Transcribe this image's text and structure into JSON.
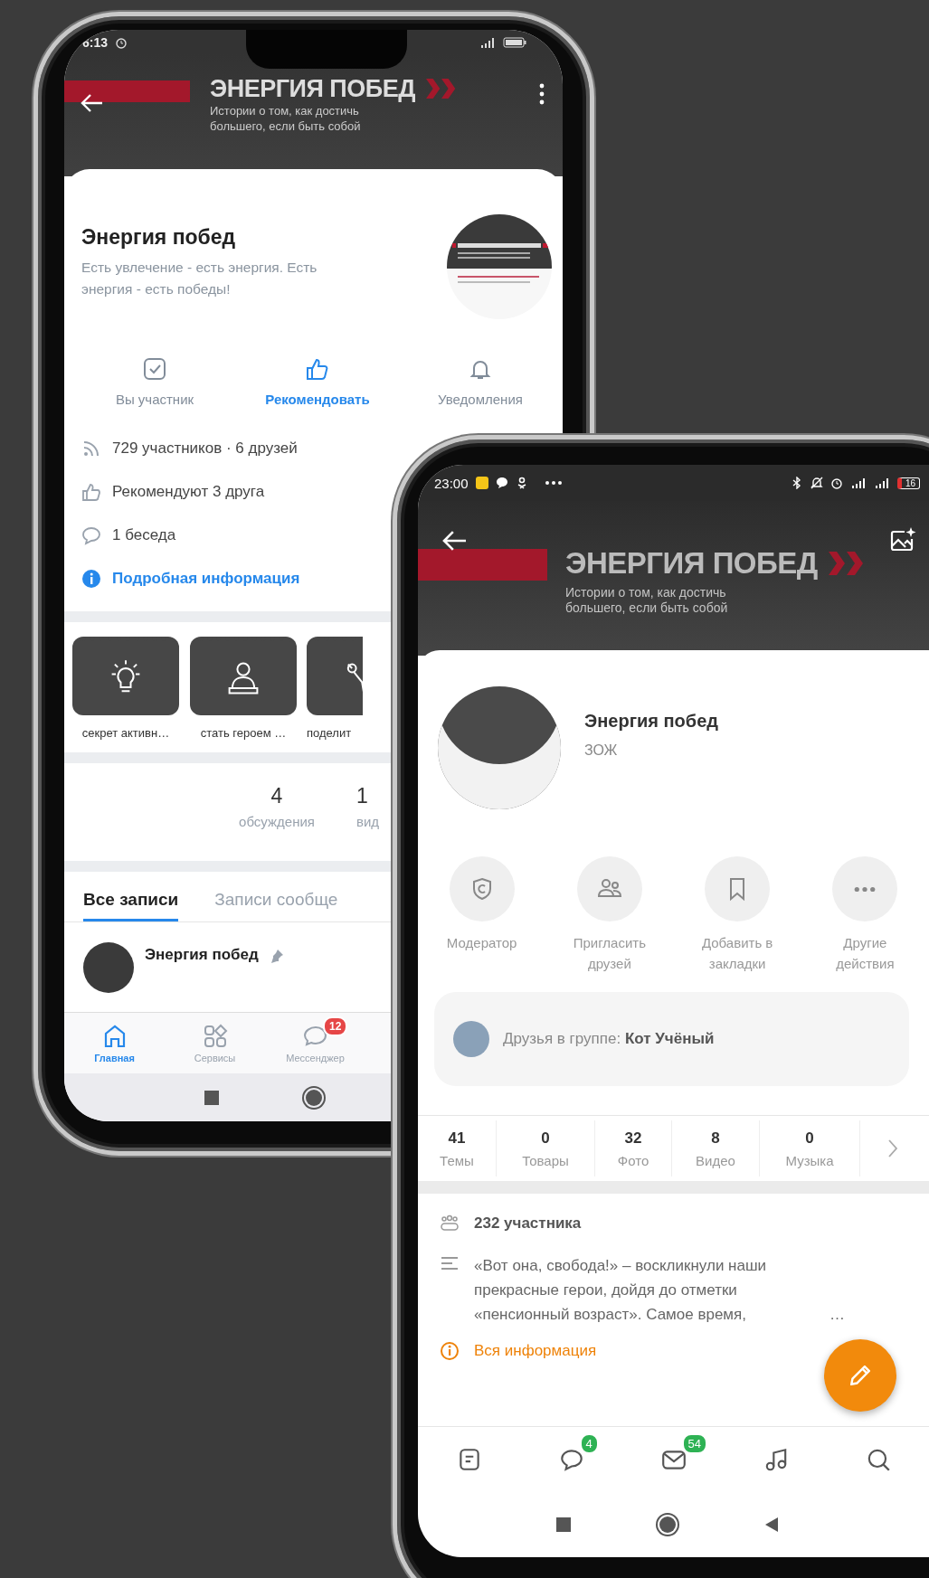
{
  "left_phone": {
    "status_bar": {
      "time": "6:13"
    },
    "cover": {
      "title": "ЭНЕРГИЯ ПОБЕД",
      "subtitle_lines": [
        "Истории о том, как достичь",
        "большего, если быть собой"
      ]
    },
    "group": {
      "name": "Энергия побед",
      "description": "Есть увлечение - есть энергия. Есть энергия - есть победы!"
    },
    "actions": [
      {
        "kind": "member",
        "label": "Вы участник",
        "highlighted": false
      },
      {
        "kind": "recommend",
        "label": "Рекомендовать",
        "highlighted": true
      },
      {
        "kind": "notifications",
        "label": "Уведомления",
        "highlighted": false
      }
    ],
    "info_rows": [
      {
        "kind": "members",
        "text": "729 участников · 6 друзей"
      },
      {
        "kind": "recommend",
        "text": "Рекомендуют 3 друга"
      },
      {
        "kind": "chat",
        "text": "1 беседа"
      },
      {
        "kind": "info",
        "text": "Подробная информация"
      }
    ],
    "stories": [
      {
        "kind": "bulb",
        "label": "секрет активн…"
      },
      {
        "kind": "person",
        "label": "стать героем …"
      },
      {
        "kind": "figure",
        "label": "поделит"
      }
    ],
    "counters": [
      {
        "value": "4",
        "label": "обсуждения"
      },
      {
        "value": "1",
        "label": "вид"
      }
    ],
    "tabs": [
      {
        "label": "Все записи",
        "selected": true
      },
      {
        "label": "Записи сообще",
        "selected": false
      }
    ],
    "post": {
      "author": "Энергия побед",
      "pinned": true
    },
    "bottom_nav": [
      {
        "kind": "home",
        "label": "Главная",
        "selected": true
      },
      {
        "kind": "services",
        "label": "Сервисы",
        "selected": false
      },
      {
        "kind": "messenger",
        "label": "Мессенджер",
        "selected": false,
        "badge": "12"
      }
    ]
  },
  "right_phone": {
    "status_bar": {
      "time": "23:00",
      "battery": "16"
    },
    "cover": {
      "title": "ЭНЕРГИЯ ПОБЕД",
      "subtitle_lines": [
        "Истории о том, как достичь",
        "большего, если быть собой"
      ]
    },
    "group": {
      "name": "Энергия побед",
      "category": "ЗОЖ"
    },
    "actions": [
      {
        "kind": "moderator",
        "label": "Модератор"
      },
      {
        "kind": "invite",
        "label": "Пригласить друзей"
      },
      {
        "kind": "bookmark",
        "label": "Добавить в закладки"
      },
      {
        "kind": "more",
        "label": "Другие действия"
      }
    ],
    "friends": {
      "text": "Друзья в группе: **Кот Учёный**"
    },
    "stats": [
      {
        "value": "41",
        "label": "Темы"
      },
      {
        "value": "0",
        "label": "Товары"
      },
      {
        "value": "32",
        "label": "Фото"
      },
      {
        "value": "8",
        "label": "Видео"
      },
      {
        "value": "0",
        "label": "Музыка"
      }
    ],
    "members": "232 участника",
    "description_lines": [
      "«Вот она, свобода!» – воскликнули наши",
      "прекрасные герои, дойдя до отметки",
      "«пенсионный возраст». Самое время,"
    ],
    "description_tail": "…",
    "info_link": "Вся информация",
    "bottom_nav": [
      {
        "kind": "feed"
      },
      {
        "kind": "chat",
        "badge": "4"
      },
      {
        "kind": "mail",
        "badge": "54"
      },
      {
        "kind": "music"
      },
      {
        "kind": "search"
      }
    ]
  }
}
